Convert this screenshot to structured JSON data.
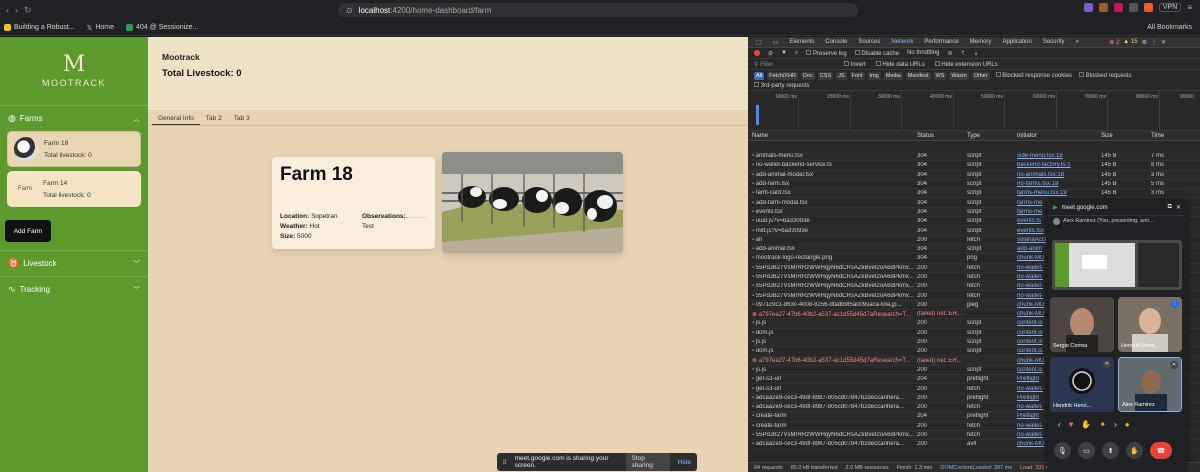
{
  "browser": {
    "url_prefix": "localhost",
    "url_rest": ":4200/home-dashboard/farm",
    "vpn": "VPN",
    "bookmarks": [
      "Building a Robust...",
      "Home",
      "404 @ Sessionize..."
    ],
    "all_bookmarks": "All Bookmarks"
  },
  "sidebar": {
    "logo_text": "MOOTRACK",
    "farms_label": "Farms",
    "farms": [
      {
        "name": "Farm 18",
        "livestock": "Total livestock: 0"
      },
      {
        "name": "Farm 14",
        "livestock": "Total livestock: 0",
        "alt": "Farm"
      }
    ],
    "add_farm": "Add Farm",
    "livestock_label": "Livestock",
    "tracking_label": "Tracking"
  },
  "main": {
    "title": "Mootrack",
    "total": "Total Livestock: 0",
    "tabs": [
      "General Info",
      "Tab 2",
      "Tab 3"
    ],
    "card": {
      "title": "Farm 18",
      "location_label": "Location:",
      "location": "Sopetran",
      "weather_label": "Weather:",
      "weather": "Hot",
      "size_label": "Size:",
      "size": "5000",
      "observations_label": "Observations:",
      "observations": "Test"
    }
  },
  "devtools": {
    "tabs": [
      "Elements",
      "Console",
      "Sources",
      "Network",
      "Performance",
      "Memory",
      "Application",
      "Security"
    ],
    "errors": "2",
    "warnings": "15",
    "preserve_log": "Preserve log",
    "disable_cache": "Disable cache",
    "throttling": "No throttling",
    "filter_placeholder": "Filter",
    "invert": "Invert",
    "hide_data_urls": "Hide data URLs",
    "hide_ext_urls": "Hide extension URLs",
    "chips": [
      "All",
      "Fetch/XHR",
      "Doc",
      "CSS",
      "JS",
      "Font",
      "Img",
      "Media",
      "Manifest",
      "WS",
      "Wasm",
      "Other"
    ],
    "blocked_cookies": "Blocked response cookies",
    "blocked_requests": "Blocked requests",
    "third_party": "3rd-party requests",
    "timeline_ticks": [
      "10000 ms",
      "20000 ms",
      "30000 ms",
      "40000 ms",
      "50000 ms",
      "60000 ms",
      "70000 ms",
      "80000 ms",
      "90000"
    ],
    "columns": [
      "Name",
      "Status",
      "Type",
      "Initiator",
      "Size",
      "Time"
    ],
    "rows": [
      {
        "name": "animals-menu.tsx",
        "status": "304",
        "type": "script",
        "initiator": "side-menu.tsx:18",
        "size": "145 B",
        "time": "7 ms"
      },
      {
        "name": "no-wallet-backend-service.ts",
        "status": "304",
        "type": "script",
        "initiator": "backend-factory.ts:1",
        "size": "145 B",
        "time": "8 ms"
      },
      {
        "name": "add-animal-modal.tsx",
        "status": "304",
        "type": "script",
        "initiator": "no-animals.tsx:18",
        "size": "145 B",
        "time": "3 ms"
      },
      {
        "name": "add-farm.tsx",
        "status": "304",
        "type": "script",
        "initiator": "no-farms.tsx:18",
        "size": "145 B",
        "time": "5 ms"
      },
      {
        "name": "farm-card.tsx",
        "status": "304",
        "type": "script",
        "initiator": "farms-menu.tsx:19",
        "size": "145 B",
        "time": "3 ms"
      },
      {
        "name": "add-farm-modal.tsx",
        "status": "304",
        "type": "script",
        "initiator": "farms-me",
        "size": "",
        "time": ""
      },
      {
        "name": "events.tsx",
        "status": "304",
        "type": "script",
        "initiator": "farms-me",
        "size": "",
        "time": ""
      },
      {
        "name": "uuid.js?v=ba33093e",
        "status": "304",
        "type": "script",
        "initiator": "events.ts",
        "size": "",
        "time": ""
      },
      {
        "name": "mitt.js?v=ba33093e",
        "status": "304",
        "type": "script",
        "initiator": "events.tsx",
        "size": "",
        "time": ""
      },
      {
        "name": "all",
        "status": "200",
        "type": "fetch",
        "initiator": "solanaAccl",
        "size": "",
        "time": ""
      },
      {
        "name": "add-animal.tsx",
        "status": "304",
        "type": "script",
        "initiator": "add-anim",
        "size": "",
        "time": ""
      },
      {
        "name": "mootrack-logo-rectangle.png",
        "status": "304",
        "type": "png",
        "initiator": "chunk-MU",
        "size": "",
        "time": ""
      },
      {
        "name": "55PdJB27VsMrRRzWWHqyN6dCRsAZkBvet2oA6dPkmx...",
        "status": "200",
        "type": "fetch",
        "initiator": "no-wallet-",
        "size": "",
        "time": ""
      },
      {
        "name": "55PdJB27VsMrRRzWWHqyN6dCRsAZkBvet2oA6dPkmx...",
        "status": "200",
        "type": "fetch",
        "initiator": "no-wallet-",
        "size": "",
        "time": ""
      },
      {
        "name": "55PdJB27VsMrRRzWWHqyN6dCRsAZkBvet2oA6dPkmx...",
        "status": "200",
        "type": "fetch",
        "initiator": "no-wallet-",
        "size": "",
        "time": ""
      },
      {
        "name": "55PdJB27VsMrRRzWWHqyN6dCRsAZkBvet2oA6dPkmx...",
        "status": "200",
        "type": "fetch",
        "initiator": "no-wallet-",
        "size": "",
        "time": ""
      },
      {
        "name": "0971c9c1-863c-4008-8256-dfadb9f5a009vaca-lola.jp...",
        "status": "200",
        "type": "jpeg",
        "initiator": "chunk-MU",
        "size": "",
        "time": ""
      },
      {
        "name": "a797ea27-47b6-40b2-a537-ac1d55d45d7aResearch=T...",
        "status": "(failed) net::ER...",
        "type": "",
        "initiator": "chunk-MU",
        "size": "",
        "time": "",
        "failed": true
      },
      {
        "name": "js.js",
        "status": "200",
        "type": "script",
        "initiator": "content.is",
        "size": "",
        "time": ""
      },
      {
        "name": "dom.js",
        "status": "200",
        "type": "script",
        "initiator": "content.is",
        "size": "",
        "time": ""
      },
      {
        "name": "js.js",
        "status": "200",
        "type": "script",
        "initiator": "content.is",
        "size": "",
        "time": ""
      },
      {
        "name": "dom.js",
        "status": "200",
        "type": "script",
        "initiator": "content.is",
        "size": "",
        "time": ""
      },
      {
        "name": "a797ea27-47b6-40b2-a537-ac1d55d45d7aResearch=T...",
        "status": "(failed) net::ER...",
        "type": "",
        "initiator": "chunk-MU",
        "size": "",
        "time": "",
        "failed": true
      },
      {
        "name": "js.js",
        "status": "200",
        "type": "script",
        "initiator": "content.is",
        "size": "",
        "time": ""
      },
      {
        "name": "get-s3-url",
        "status": "204",
        "type": "preflight",
        "initiator": "Preflight",
        "size": "",
        "time": ""
      },
      {
        "name": "get-s3-url",
        "status": "200",
        "type": "fetch",
        "initiator": "no-wallet-",
        "size": "",
        "time": ""
      },
      {
        "name": "adcaa2e9-cec3-49df-8987-b05cd07847b2deccanhera...",
        "status": "200",
        "type": "preflight",
        "initiator": "Preflight",
        "size": "",
        "time": ""
      },
      {
        "name": "adcaa2e9-cec3-49df-8987-b05cd07847b2deccanhera...",
        "status": "200",
        "type": "fetch",
        "initiator": "no-wallet-",
        "size": "",
        "time": ""
      },
      {
        "name": "create-farm",
        "status": "204",
        "type": "preflight",
        "initiator": "Preflight",
        "size": "",
        "time": ""
      },
      {
        "name": "create-farm",
        "status": "200",
        "type": "fetch",
        "initiator": "no-wallet-",
        "size": "",
        "time": ""
      },
      {
        "name": "55PdJB27VsMrRRzWWHqyN6dCRsAZkBvet2oA6dPkmx...",
        "status": "200",
        "type": "fetch",
        "initiator": "no-wallet-",
        "size": "",
        "time": ""
      },
      {
        "name": "adcaa2e9-cec3-49df-8987-b05cd07847b2deccanhera...",
        "status": "200",
        "type": "avif",
        "initiator": "chunk-MU",
        "size": "",
        "time": ""
      }
    ],
    "status_bar": {
      "requests": "64 requests",
      "transferred": "85.0 kB transferred",
      "resources": "2.0 MB resources",
      "finish": "Finish: 1.3 min",
      "dcl": "DOMContentLoaded: 307 ms",
      "load": "Load: 335 ms"
    }
  },
  "meet": {
    "title": "meet.google.com",
    "presenting": "Alex Ramirez (You, presenting, ann...",
    "participants": [
      "Sergio Correa",
      "Hendrik Henri...",
      "Hendrik Henri...",
      "Alex Ramirez"
    ]
  },
  "share_bar": {
    "text": "meet.google.com is sharing your screen.",
    "stop": "Stop sharing",
    "hide": "Hide"
  },
  "colors": {
    "sidebar_green": "#5c9a2d",
    "page_beige": "#e8d4b5",
    "card_bg": "#fbeedd"
  }
}
